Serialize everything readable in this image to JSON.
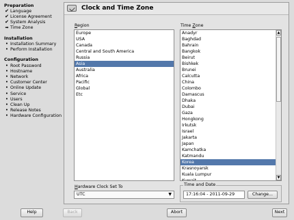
{
  "sidebar": {
    "sections": [
      {
        "title": "Preparation",
        "items": [
          {
            "label": "Language",
            "state": "done"
          },
          {
            "label": "License Agreement",
            "state": "done"
          },
          {
            "label": "System Analysis",
            "state": "done"
          },
          {
            "label": "Time Zone",
            "state": "current"
          }
        ]
      },
      {
        "title": "Installation",
        "items": [
          {
            "label": "Installation Summary",
            "state": "pending"
          },
          {
            "label": "Perform Installation",
            "state": "pending"
          }
        ]
      },
      {
        "title": "Configuration",
        "items": [
          {
            "label": "Root Password",
            "state": "pending"
          },
          {
            "label": "Hostname",
            "state": "pending"
          },
          {
            "label": "Network",
            "state": "pending"
          },
          {
            "label": "Customer Center",
            "state": "pending"
          },
          {
            "label": "Online Update",
            "state": "pending"
          },
          {
            "label": "Service",
            "state": "pending"
          },
          {
            "label": "Users",
            "state": "pending"
          },
          {
            "label": "Clean Up",
            "state": "pending"
          },
          {
            "label": "Release Notes",
            "state": "pending"
          },
          {
            "label": "Hardware Configuration",
            "state": "pending"
          }
        ]
      }
    ]
  },
  "panel": {
    "title": "Clock and Time Zone",
    "region_label_prefix": "R",
    "region_label_rest": "egion",
    "timezone_label_prefix": "Time ",
    "timezone_label_u": "Z",
    "timezone_label_rest": "one",
    "regions": [
      "Europe",
      "USA",
      "Canada",
      "Central and South America",
      "Russia",
      "Asia",
      "Australia",
      "Africa",
      "Pacific",
      "Global",
      "Etc"
    ],
    "selected_region": "Asia",
    "timezones": [
      "Anadyr",
      "Baghdad",
      "Bahrain",
      "Bangkok",
      "Beirut",
      "Bishkek",
      "Brunei",
      "Calcutta",
      "China",
      "Colombo",
      "Damascus",
      "Dhaka",
      "Dubai",
      "Gaza",
      "Hongkong",
      "Irkutsk",
      "Israel",
      "Jakarta",
      "Japan",
      "Kamchatka",
      "Katmandu",
      "Korea",
      "Krasnoyarsk",
      "Kuala Lumpur",
      "Kuwait"
    ],
    "selected_timezone": "Korea",
    "hw_clock_label_u": "H",
    "hw_clock_label_rest": "ardware Clock Set To",
    "hw_clock_value": "UTC",
    "time_date_label": "Time and Date",
    "time_date_value": "17:16:04 - 2011-09-29",
    "change_button": "Change..."
  },
  "footer": {
    "help": "Help",
    "back": "Back",
    "abort": "Abort",
    "next": "Next"
  }
}
